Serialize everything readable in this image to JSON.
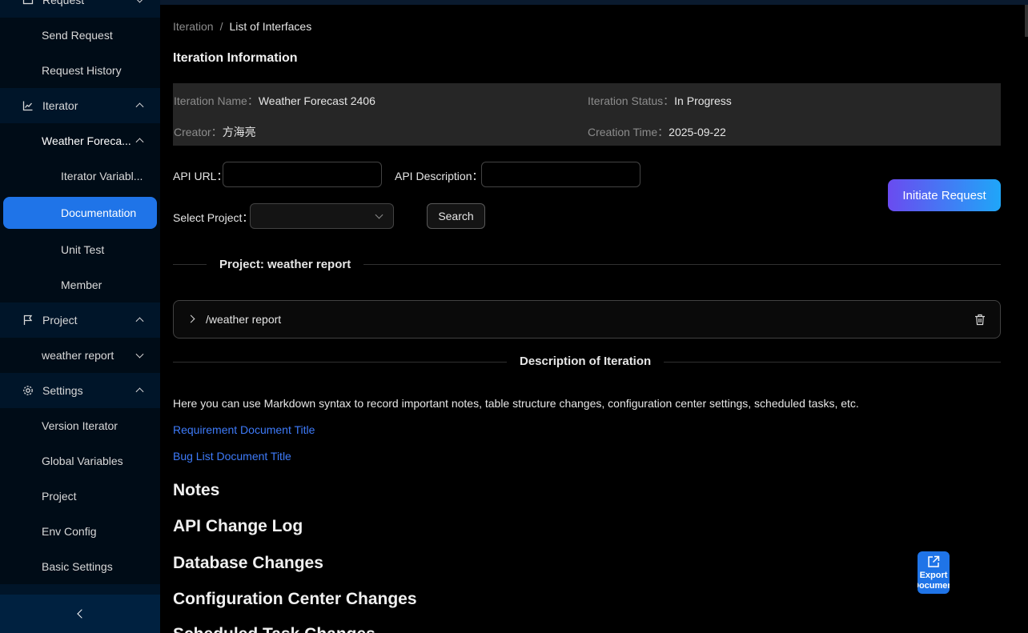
{
  "sidebar": {
    "items": [
      {
        "label": "Request"
      },
      {
        "label": "Send Request"
      },
      {
        "label": "Request History"
      },
      {
        "label": "Iterator"
      },
      {
        "label": "Weather Foreca..."
      },
      {
        "label": "Iterator Variabl..."
      },
      {
        "label": "Documentation"
      },
      {
        "label": "Unit Test"
      },
      {
        "label": "Member"
      },
      {
        "label": "Project"
      },
      {
        "label": "weather report"
      },
      {
        "label": "Settings"
      },
      {
        "label": "Version Iterator"
      },
      {
        "label": "Global Variables"
      },
      {
        "label": "Project"
      },
      {
        "label": "Env Config"
      },
      {
        "label": "Basic Settings"
      }
    ]
  },
  "breadcrumb": {
    "root": "Iteration",
    "sep": "/",
    "current": "List of Interfaces"
  },
  "iteration_info": {
    "title": "Iteration Information",
    "name_label": "Iteration Name：",
    "name_value": "Weather Forecast 2406",
    "status_label": "Iteration Status：",
    "status_value": "In Progress",
    "creator_label": "Creator：",
    "creator_value": "方海亮",
    "time_label": "Creation Time：",
    "time_value": "2025-09-22"
  },
  "filters": {
    "api_url_label": "API URL：",
    "api_url_value": "",
    "api_desc_label": "API Description：",
    "api_desc_value": "",
    "project_label": "Select Project：",
    "project_value": "",
    "search_label": "Search",
    "initiate_label": "Initiate Request"
  },
  "project_section": {
    "divider_title": "Project: weather report",
    "panel_title": "/weather report"
  },
  "description": {
    "divider_title": "Description of Iteration",
    "intro": "Here you can use Markdown syntax to record important notes, table structure changes, configuration center settings, scheduled tasks, etc.",
    "link1": "Requirement Document Title",
    "link2": "Bug List Document Title",
    "headings": [
      "Notes",
      "API Change Log",
      "Database Changes",
      "Configuration Center Changes",
      "Scheduled Task Changes"
    ]
  },
  "export": {
    "line1": "Export",
    "line2": "Document"
  },
  "colors": {
    "accent": "#1f74e8",
    "sidebar_bg": "#001529",
    "link": "#3e7bfa",
    "gradient_start": "#6a4bf0",
    "gradient_end": "#1fa6f8"
  }
}
